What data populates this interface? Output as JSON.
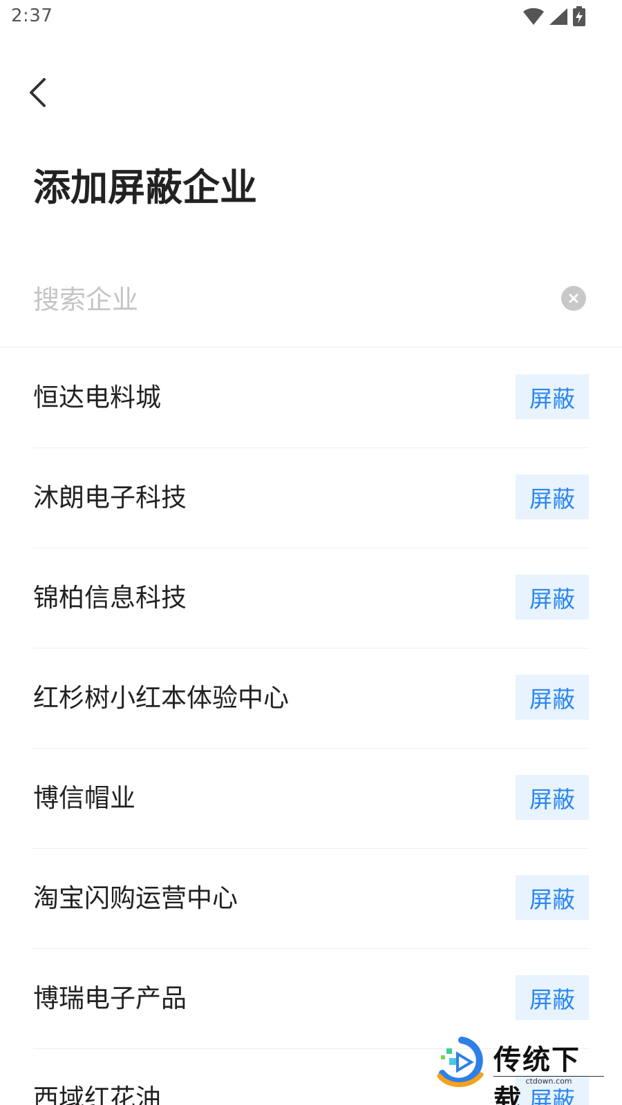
{
  "status_bar": {
    "time": "2:37",
    "icons": [
      "wifi-icon",
      "signal-icon",
      "battery-charging-icon"
    ]
  },
  "header": {
    "back_icon": "chevron-left-icon",
    "title": "添加屏蔽企业"
  },
  "search": {
    "placeholder": "搜索企业",
    "value": "",
    "clear_icon": "clear-icon"
  },
  "colors": {
    "accent": "#2a86f2",
    "button_bg": "#e8f3fe",
    "divider": "#eeeeee"
  },
  "companies": [
    {
      "name": "恒达电料城",
      "action": "屏蔽"
    },
    {
      "name": "沐朗电子科技",
      "action": "屏蔽"
    },
    {
      "name": "锦柏信息科技",
      "action": "屏蔽"
    },
    {
      "name": "红杉树小红本体验中心",
      "action": "屏蔽"
    },
    {
      "name": "博信帽业",
      "action": "屏蔽"
    },
    {
      "name": "淘宝闪购运营中心",
      "action": "屏蔽"
    },
    {
      "name": "博瑞电子产品",
      "action": "屏蔽"
    },
    {
      "name": "西域红花油",
      "action": "屏蔽"
    }
  ],
  "watermark": {
    "text": "传统下载",
    "url_text": "ctdown.com"
  }
}
